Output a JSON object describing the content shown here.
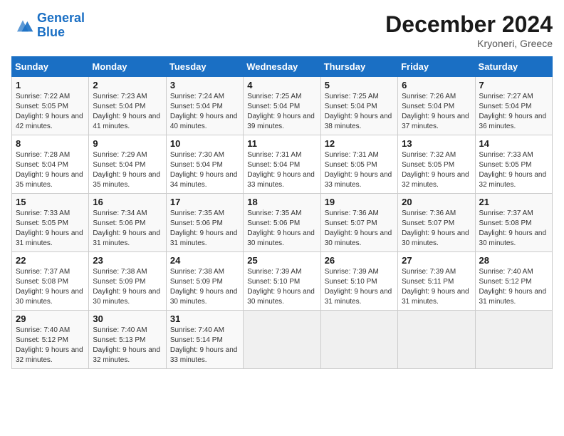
{
  "header": {
    "logo_line1": "General",
    "logo_line2": "Blue",
    "title": "December 2024",
    "subtitle": "Kryoneri, Greece"
  },
  "calendar": {
    "days_of_week": [
      "Sunday",
      "Monday",
      "Tuesday",
      "Wednesday",
      "Thursday",
      "Friday",
      "Saturday"
    ],
    "weeks": [
      [
        null,
        {
          "day": "2",
          "sunrise": "7:23 AM",
          "sunset": "5:04 PM",
          "daylight": "9 hours and 41 minutes."
        },
        {
          "day": "3",
          "sunrise": "7:24 AM",
          "sunset": "5:04 PM",
          "daylight": "9 hours and 40 minutes."
        },
        {
          "day": "4",
          "sunrise": "7:25 AM",
          "sunset": "5:04 PM",
          "daylight": "9 hours and 39 minutes."
        },
        {
          "day": "5",
          "sunrise": "7:25 AM",
          "sunset": "5:04 PM",
          "daylight": "9 hours and 38 minutes."
        },
        {
          "day": "6",
          "sunrise": "7:26 AM",
          "sunset": "5:04 PM",
          "daylight": "9 hours and 37 minutes."
        },
        {
          "day": "7",
          "sunrise": "7:27 AM",
          "sunset": "5:04 PM",
          "daylight": "9 hours and 36 minutes."
        }
      ],
      [
        {
          "day": "1",
          "sunrise": "7:22 AM",
          "sunset": "5:05 PM",
          "daylight": "9 hours and 42 minutes."
        },
        null,
        null,
        null,
        null,
        null,
        null
      ],
      [
        {
          "day": "8",
          "sunrise": "7:28 AM",
          "sunset": "5:04 PM",
          "daylight": "9 hours and 35 minutes."
        },
        {
          "day": "9",
          "sunrise": "7:29 AM",
          "sunset": "5:04 PM",
          "daylight": "9 hours and 35 minutes."
        },
        {
          "day": "10",
          "sunrise": "7:30 AM",
          "sunset": "5:04 PM",
          "daylight": "9 hours and 34 minutes."
        },
        {
          "day": "11",
          "sunrise": "7:31 AM",
          "sunset": "5:04 PM",
          "daylight": "9 hours and 33 minutes."
        },
        {
          "day": "12",
          "sunrise": "7:31 AM",
          "sunset": "5:05 PM",
          "daylight": "9 hours and 33 minutes."
        },
        {
          "day": "13",
          "sunrise": "7:32 AM",
          "sunset": "5:05 PM",
          "daylight": "9 hours and 32 minutes."
        },
        {
          "day": "14",
          "sunrise": "7:33 AM",
          "sunset": "5:05 PM",
          "daylight": "9 hours and 32 minutes."
        }
      ],
      [
        {
          "day": "15",
          "sunrise": "7:33 AM",
          "sunset": "5:05 PM",
          "daylight": "9 hours and 31 minutes."
        },
        {
          "day": "16",
          "sunrise": "7:34 AM",
          "sunset": "5:06 PM",
          "daylight": "9 hours and 31 minutes."
        },
        {
          "day": "17",
          "sunrise": "7:35 AM",
          "sunset": "5:06 PM",
          "daylight": "9 hours and 31 minutes."
        },
        {
          "day": "18",
          "sunrise": "7:35 AM",
          "sunset": "5:06 PM",
          "daylight": "9 hours and 30 minutes."
        },
        {
          "day": "19",
          "sunrise": "7:36 AM",
          "sunset": "5:07 PM",
          "daylight": "9 hours and 30 minutes."
        },
        {
          "day": "20",
          "sunrise": "7:36 AM",
          "sunset": "5:07 PM",
          "daylight": "9 hours and 30 minutes."
        },
        {
          "day": "21",
          "sunrise": "7:37 AM",
          "sunset": "5:08 PM",
          "daylight": "9 hours and 30 minutes."
        }
      ],
      [
        {
          "day": "22",
          "sunrise": "7:37 AM",
          "sunset": "5:08 PM",
          "daylight": "9 hours and 30 minutes."
        },
        {
          "day": "23",
          "sunrise": "7:38 AM",
          "sunset": "5:09 PM",
          "daylight": "9 hours and 30 minutes."
        },
        {
          "day": "24",
          "sunrise": "7:38 AM",
          "sunset": "5:09 PM",
          "daylight": "9 hours and 30 minutes."
        },
        {
          "day": "25",
          "sunrise": "7:39 AM",
          "sunset": "5:10 PM",
          "daylight": "9 hours and 30 minutes."
        },
        {
          "day": "26",
          "sunrise": "7:39 AM",
          "sunset": "5:10 PM",
          "daylight": "9 hours and 31 minutes."
        },
        {
          "day": "27",
          "sunrise": "7:39 AM",
          "sunset": "5:11 PM",
          "daylight": "9 hours and 31 minutes."
        },
        {
          "day": "28",
          "sunrise": "7:40 AM",
          "sunset": "5:12 PM",
          "daylight": "9 hours and 31 minutes."
        }
      ],
      [
        {
          "day": "29",
          "sunrise": "7:40 AM",
          "sunset": "5:12 PM",
          "daylight": "9 hours and 32 minutes."
        },
        {
          "day": "30",
          "sunrise": "7:40 AM",
          "sunset": "5:13 PM",
          "daylight": "9 hours and 32 minutes."
        },
        {
          "day": "31",
          "sunrise": "7:40 AM",
          "sunset": "5:14 PM",
          "daylight": "9 hours and 33 minutes."
        },
        null,
        null,
        null,
        null
      ]
    ]
  }
}
